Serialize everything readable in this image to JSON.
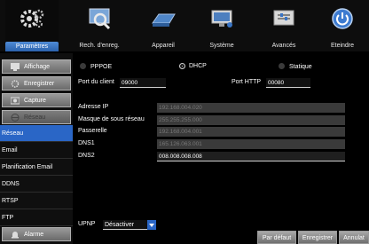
{
  "topnav": {
    "tabs": [
      {
        "label": "Paramètres",
        "icon": "gear-icon"
      },
      {
        "label": "Rech. d'enreg.",
        "icon": "search-icon"
      },
      {
        "label": "Appareil",
        "icon": "hard-disk-icon"
      },
      {
        "label": "Système",
        "icon": "monitor-icon"
      },
      {
        "label": "Avancés",
        "icon": "settings-box-icon"
      },
      {
        "label": "Eteindre",
        "icon": "power-icon"
      }
    ]
  },
  "sidebar": {
    "main_items": [
      {
        "label": "Affichage",
        "icon": "display-icon"
      },
      {
        "label": "Enregistrer",
        "icon": "record-gear-icon"
      },
      {
        "label": "Capture",
        "icon": "capture-icon"
      },
      {
        "label": "Réseau",
        "icon": "network-icon"
      }
    ],
    "sub_items": [
      "Réseau",
      "Email",
      "Planification Email",
      "DDNS",
      "RTSP",
      "FTP"
    ],
    "bottom_item": {
      "label": "Alarme",
      "icon": "alarm-icon"
    }
  },
  "network": {
    "modes": [
      "PPPOE",
      "DHCP",
      "Statique"
    ],
    "selected_mode": "DHCP",
    "client_port_label": "Port du client",
    "client_port": "09000",
    "http_port_label": "Port HTTP",
    "http_port": "00080",
    "ip_label": "Adresse IP",
    "ip": "192.168.004.020",
    "mask_label": "Masque de sous réseau",
    "mask": "255.255.255.000",
    "gateway_label": "Passerelle",
    "gateway": "192.168.004.001",
    "dns1_label": "DNS1",
    "dns1": "165.126.063.001",
    "dns2_label": "DNS2",
    "dns2": "008.008.008.008",
    "upnp_label": "UPNP",
    "upnp_value": "Désactiver"
  },
  "buttons": {
    "default": "Par défaut",
    "save": "Enregistrer",
    "cancel": "Annulat"
  },
  "colors": {
    "accent": "#2a66c6",
    "background": "#000000"
  }
}
